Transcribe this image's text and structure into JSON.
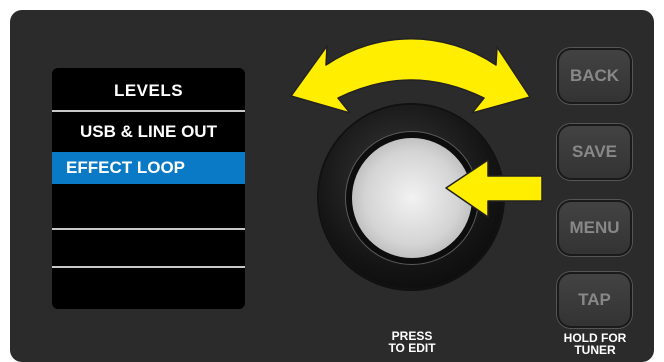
{
  "screen": {
    "title": "LEVELS",
    "items": [
      {
        "label": "USB & LINE OUT",
        "selected": false
      },
      {
        "label": "EFFECT LOOP",
        "selected": true
      },
      {
        "label": "",
        "selected": false
      },
      {
        "label": "",
        "selected": false
      }
    ]
  },
  "encoder": {
    "caption_line1": "PRESS",
    "caption_line2": "TO EDIT"
  },
  "buttons": {
    "back": "BACK",
    "save": "SAVE",
    "menu": "MENU",
    "tap": "TAP",
    "tap_caption_line1": "HOLD FOR",
    "tap_caption_line2": "TUNER"
  },
  "colors": {
    "panel": "#2b2b2b",
    "highlight": "#0a79c6",
    "arrow": "#ffee00",
    "button_text": "#888888"
  },
  "icons": {
    "rotate": "curved-double-arrow-icon",
    "press": "left-arrow-icon"
  }
}
